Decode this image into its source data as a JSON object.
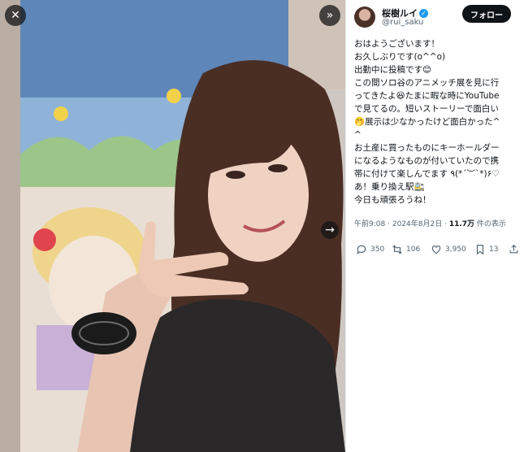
{
  "overlay": {
    "close_glyph": "✕",
    "expand_glyph": "»",
    "next_glyph": "→"
  },
  "user": {
    "display_name": "桜樹ルイ",
    "handle": "@rui_saku",
    "follow_label": "フォロー",
    "verified": true,
    "verified_color": "#1d9bf0"
  },
  "post": {
    "lines": [
      "おはようございます！",
      "お久しぶりです(o^^o)",
      "出勤中に投稿です😊",
      "この間ソロ谷のアニメッチ展を見に行",
      "ってきたよ😆たまに暇な時にYouTube",
      "で見てるの。短いストーリーで面白い",
      "🤭展示は少なかったけど面白かった^",
      "^",
      "お土産に買ったものにキーホールダー",
      "になるようなものが付いていたので携",
      "帯に付けて楽しんでます ٩(*´︶`*)۶♡",
      "あ！乗り換え駅🚉",
      "今日も頑張ろうね！"
    ],
    "time": "午前9:08",
    "sep": "·",
    "date": "2024年8月2日",
    "views_count": "11.7万",
    "views_label": "件の表示"
  },
  "actions": {
    "replies": "350",
    "reposts": "106",
    "likes": "3,950",
    "bookmarks": "13"
  },
  "colors": {
    "text": "#0f1419",
    "secondary": "#536471",
    "button_bg": "#0f1419"
  }
}
